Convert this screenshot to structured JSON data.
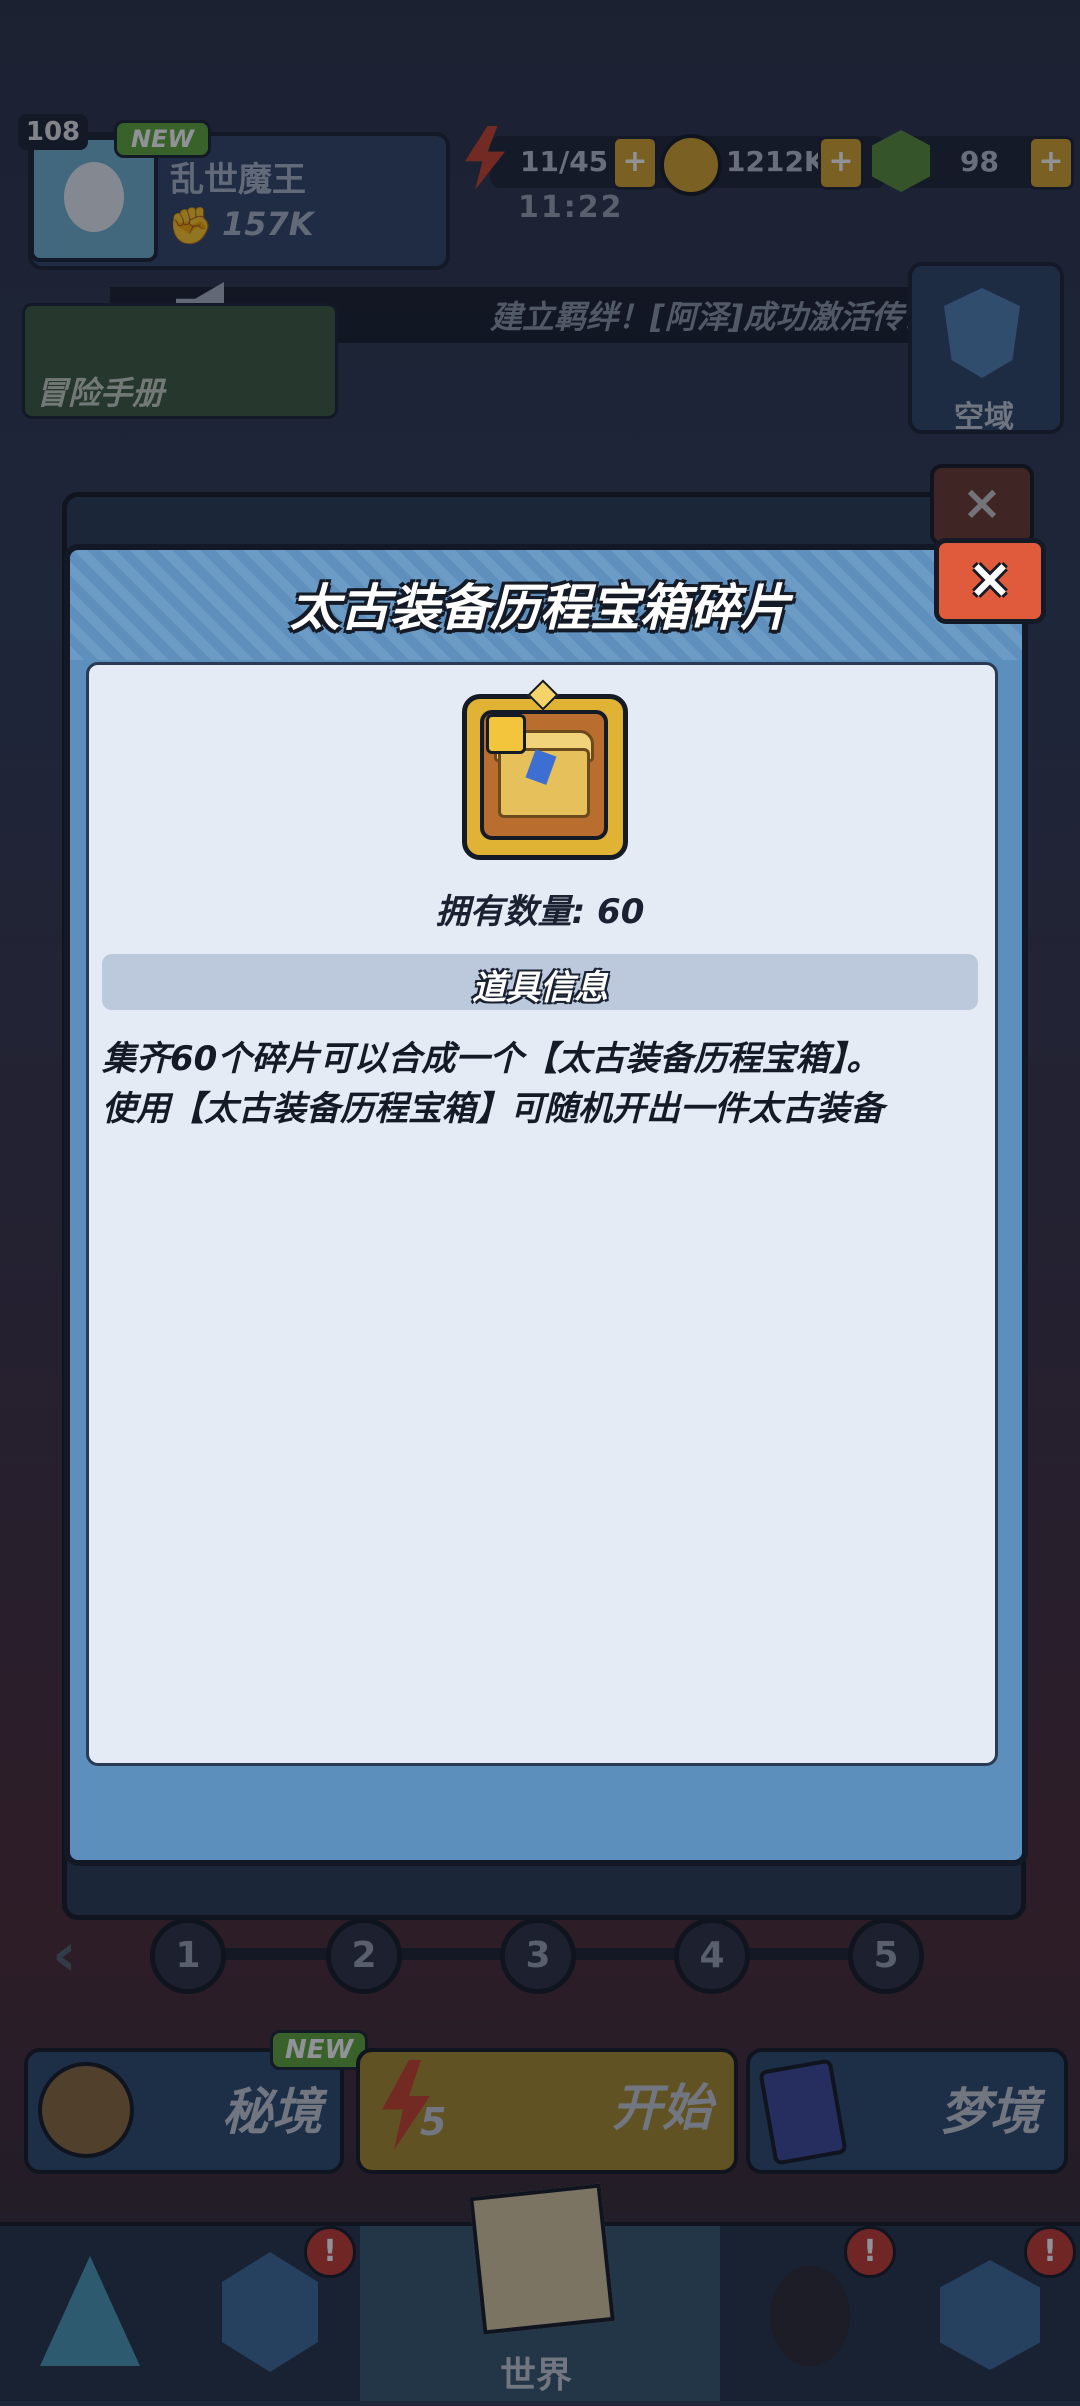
{
  "header": {
    "level": "108",
    "new_badge": "NEW",
    "player_name": "乱世魔王",
    "power": "157K",
    "energy": "11/45",
    "energy_timer": "11:22",
    "gold": "1212K",
    "gems": "98",
    "plus": "+"
  },
  "banner": {
    "text": "建立羁绊！[阿泽]成功激活传说"
  },
  "shortcuts": {
    "adventure_manual": "冒险手册",
    "airfield": "空域"
  },
  "background_dialog": {
    "close": "×"
  },
  "stages": {
    "prev": "‹",
    "nodes": [
      "1",
      "2",
      "3",
      "4",
      "5"
    ]
  },
  "actions": {
    "secret_realm": "秘境",
    "secret_new": "NEW",
    "start": "开始",
    "start_energy": "5",
    "dreamland": "梦境"
  },
  "nav": {
    "world": "世界",
    "alert": "!"
  },
  "dialog": {
    "title": "太古装备历程宝箱碎片",
    "close": "×",
    "owned_count": "拥有数量: 60",
    "section_title": "道具信息",
    "description_line1": "集齐60个碎片可以合成一个【太古装备历程宝箱】。",
    "description_line2": "使用【太古装备历程宝箱】可随机开出一件太古装备"
  },
  "colors": {
    "dialog_blue": "#5d8fbd",
    "panel": "#e4ebf5",
    "close_red": "#e05a3c",
    "item_gold": "#e0b335"
  }
}
